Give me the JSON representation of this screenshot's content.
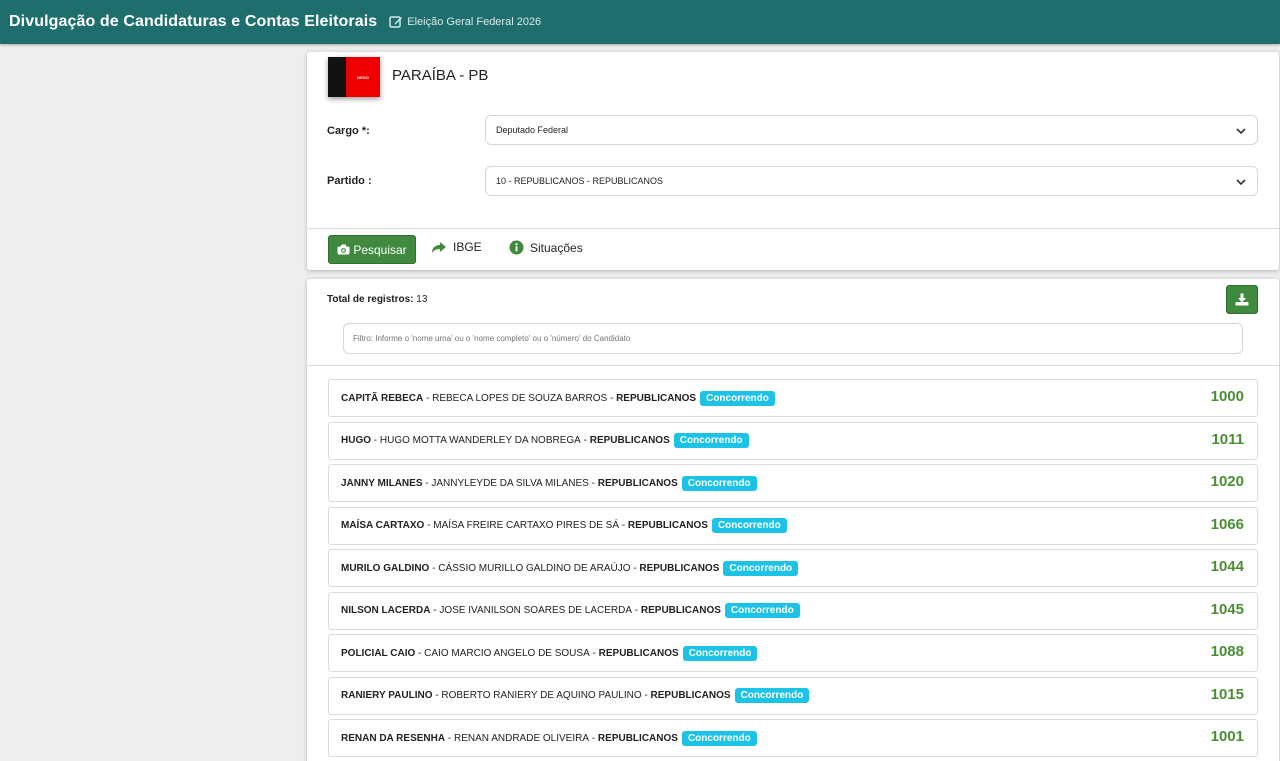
{
  "header": {
    "title": "Divulgação de Candidaturas e Contas Eleitorais",
    "edit_icon": "edit-icon",
    "election": "Eleição Geral Federal 2026"
  },
  "state": {
    "flag_text": "NEGO",
    "title": "PARAÍBA - PB"
  },
  "form": {
    "cargo_label": "Cargo *:",
    "cargo_value": "Deputado Federal",
    "partido_label": "Partido :",
    "partido_value": "10 - REPUBLICANOS - REPUBLICANOS"
  },
  "actions": {
    "search_label": "Pesquisar",
    "search_icon": "camera-icon",
    "ibge_label": "IBGE",
    "ibge_icon": "share-icon",
    "situacoes_label": "Situações",
    "situacoes_icon": "info-icon"
  },
  "results": {
    "total_label": "Total de registros:",
    "total_value": "13",
    "download_icon": "download-icon",
    "filter_placeholder": "Filtro: Informe o 'nome urna' ou o 'nome completo' ou o 'número' do Candidato",
    "status_color": "#1cc3e6",
    "number_color": "#4a8f34",
    "items": [
      {
        "nick": "CAPITÃ REBECA",
        "full": "REBECA LOPES DE SOUZA BARROS",
        "party": "REPUBLICANOS",
        "status": "Concorrendo",
        "number": "1000"
      },
      {
        "nick": "HUGO",
        "full": "HUGO MOTTA WANDERLEY DA NOBREGA",
        "party": "REPUBLICANOS",
        "status": "Concorrendo",
        "number": "1011"
      },
      {
        "nick": "JANNY MILANES",
        "full": "JANNYLEYDE DA SILVA MILANES",
        "party": "REPUBLICANOS",
        "status": "Concorrendo",
        "number": "1020"
      },
      {
        "nick": "MAÍSA CARTAXO",
        "full": "MAÍSA FREIRE CARTAXO PIRES DE SÁ",
        "party": "REPUBLICANOS",
        "status": "Concorrendo",
        "number": "1066"
      },
      {
        "nick": "MURILO GALDINO",
        "full": "CÁSSIO MURILLO GALDINO DE ARAÚJO",
        "party": "REPUBLICANOS",
        "status": "Concorrendo",
        "number": "1044"
      },
      {
        "nick": "NILSON LACERDA",
        "full": "JOSE IVANILSON SOARES DE LACERDA",
        "party": "REPUBLICANOS",
        "status": "Concorrendo",
        "number": "1045"
      },
      {
        "nick": "POLICIAL CAIO",
        "full": "CAIO MARCIO ANGELO DE SOUSA",
        "party": "REPUBLICANOS",
        "status": "Concorrendo",
        "number": "1088"
      },
      {
        "nick": "RANIERY PAULINO",
        "full": "ROBERTO RANIERY DE AQUINO PAULINO",
        "party": "REPUBLICANOS",
        "status": "Concorrendo",
        "number": "1015"
      },
      {
        "nick": "RENAN DA RESENHA",
        "full": "RENAN ANDRADE OLIVEIRA",
        "party": "REPUBLICANOS",
        "status": "Concorrendo",
        "number": "1001"
      }
    ]
  }
}
